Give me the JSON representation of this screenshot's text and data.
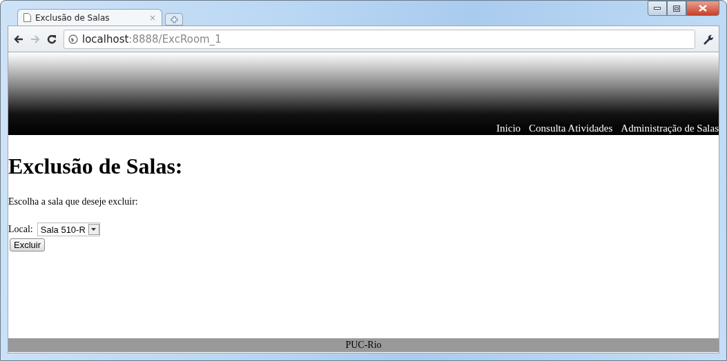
{
  "browser": {
    "tab": {
      "title": "Exclusão de Salas",
      "close": "×",
      "selected": true
    },
    "url": {
      "host": "localhost",
      "path": ":8888/ExcRoom_1"
    }
  },
  "nav": [
    {
      "label": "Inicio"
    },
    {
      "label": "Consulta Atividades"
    },
    {
      "label": "Administração de Salas"
    }
  ],
  "heading": "Exclusão de Salas:",
  "instruction": "Escolha a sala que deseje excluir:",
  "form": {
    "label": "Local:",
    "select_value": "Sala 510-R",
    "button": "Excluir"
  },
  "footer": "PUC-Rio"
}
